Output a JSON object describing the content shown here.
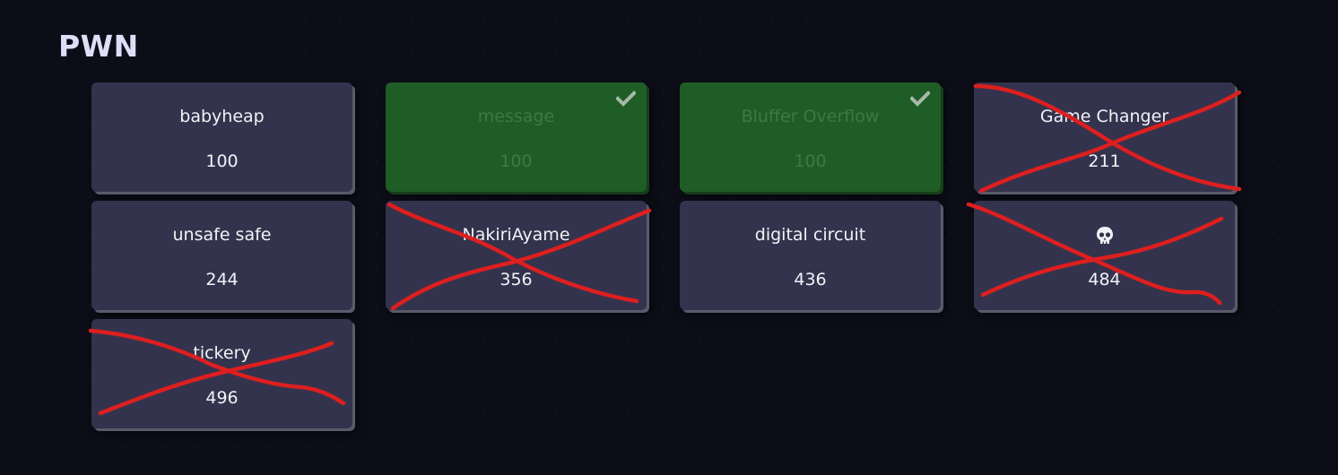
{
  "category": {
    "title": "PWN"
  },
  "challenges": [
    {
      "name": "babyheap",
      "points": "100",
      "solved": false,
      "crossed": false
    },
    {
      "name": "message",
      "points": "100",
      "solved": true,
      "crossed": false
    },
    {
      "name": "Bluffer Overflow",
      "points": "100",
      "solved": true,
      "crossed": false
    },
    {
      "name": "Game Changer",
      "points": "211",
      "solved": false,
      "crossed": true
    },
    {
      "name": "unsafe safe",
      "points": "244",
      "solved": false,
      "crossed": false
    },
    {
      "name": "NakiriAyame",
      "points": "356",
      "solved": false,
      "crossed": true
    },
    {
      "name": "digital circuit",
      "points": "436",
      "solved": false,
      "crossed": false
    },
    {
      "name": "",
      "name_icon": "skull-icon",
      "points": "484",
      "solved": false,
      "crossed": true
    },
    {
      "name": "tickery",
      "points": "496",
      "solved": false,
      "crossed": true
    }
  ],
  "icons": {
    "solved": "check-icon",
    "crossed": "red-cross-annotation"
  },
  "colors": {
    "background": "#0c0d17",
    "card": "#34334d",
    "card_solved": "#1e5d25",
    "solved_text": "#3d7a43",
    "cross_out": "#dd1f1f"
  }
}
